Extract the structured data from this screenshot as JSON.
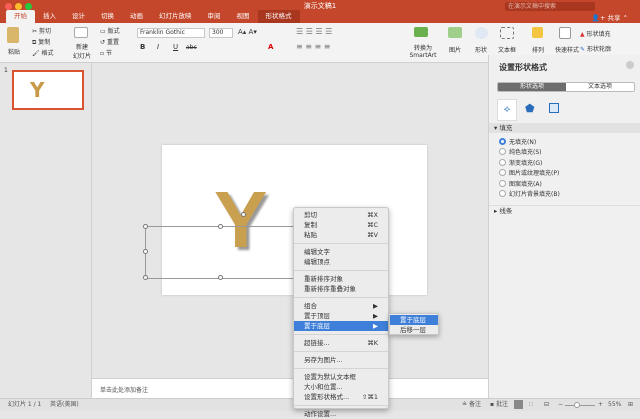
{
  "window": {
    "title": "演示文稿1",
    "search_placeholder": "在演示文稿中搜索",
    "share": "共享"
  },
  "tabs": [
    "开始",
    "插入",
    "设计",
    "切换",
    "动画",
    "幻灯片放映",
    "审阅",
    "视图",
    "形状格式"
  ],
  "ribbon": {
    "paste": "粘贴",
    "cut": "剪切",
    "copy": "复制",
    "format": "格式",
    "new_slide": "新建\n幻灯片",
    "layout": "版式",
    "reset": "重置",
    "section": "节",
    "font": "Franklin Gothic",
    "size": "300",
    "convert": "转换为SmartArt",
    "picture": "图片",
    "shape": "形状",
    "textbox": "文本框",
    "arrange": "排列",
    "quick_styles": "快速样式",
    "shape_fill": "形状填充",
    "shape_outline": "形状轮廓",
    "bold": "B",
    "italic": "I",
    "underline": "U",
    "strike": "abc"
  },
  "thumbs": {
    "number": "1",
    "letter": "Y"
  },
  "slide": {
    "letter": "Y"
  },
  "notes": "单击此处添加备注",
  "pane": {
    "title": "设置形状格式",
    "tab_shape": "形状选项",
    "tab_text": "文本选项",
    "fill_section": "填充",
    "fill_options": [
      "无填充(N)",
      "纯色填充(S)",
      "渐变填充(G)",
      "图片或纹理填充(P)",
      "图案填充(A)",
      "幻灯片背景填充(B)"
    ],
    "selected_fill": 0,
    "line_section": "线条"
  },
  "menu": [
    {
      "label": "剪切",
      "shortcut": "⌘X"
    },
    {
      "label": "复制",
      "shortcut": "⌘C"
    },
    {
      "label": "粘贴",
      "shortcut": "⌘V"
    },
    {
      "label": "编辑文字",
      "shortcut": ""
    },
    {
      "label": "编辑顶点",
      "shortcut": ""
    },
    {
      "label": "重新排序对象",
      "shortcut": ""
    },
    {
      "label": "重新排序重叠对象",
      "shortcut": ""
    },
    {
      "label": "组合",
      "shortcut": "▶"
    },
    {
      "label": "置于顶层",
      "shortcut": "▶"
    },
    {
      "label": "置于底层",
      "shortcut": "▶"
    },
    {
      "label": "超链接...",
      "shortcut": "⌘K"
    },
    {
      "label": "另存为图片...",
      "shortcut": ""
    },
    {
      "label": "设置为默认文本框",
      "shortcut": ""
    },
    {
      "label": "大小和位置...",
      "shortcut": ""
    },
    {
      "label": "设置形状格式...",
      "shortcut": "⇧⌘1"
    },
    {
      "label": "动作设置...",
      "shortcut": ""
    }
  ],
  "submenu": [
    "置于底层",
    "后移一层"
  ],
  "status": {
    "slide": "幻灯片 1 / 1",
    "lang": "英语(美国)",
    "notes": "备注",
    "comments": "批注",
    "zoom": "55%"
  }
}
